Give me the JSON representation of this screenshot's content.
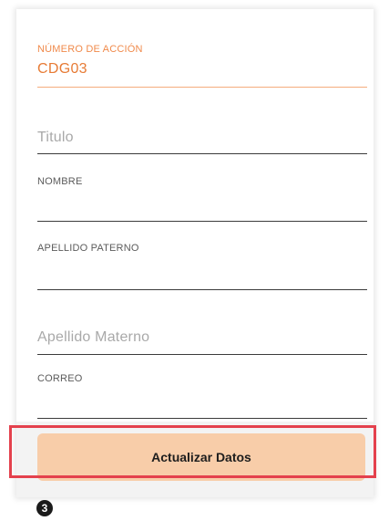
{
  "form": {
    "action_number": {
      "label": "NÚMERO DE ACCIÓN",
      "value": "CDG03"
    },
    "title": {
      "placeholder": "Titulo"
    },
    "first_name": {
      "label": "NOMBRE"
    },
    "paternal_surname": {
      "label": "APELLIDO PATERNO"
    },
    "maternal_surname": {
      "placeholder": "Apellido Materno"
    },
    "email": {
      "label": "CORREO"
    }
  },
  "button": {
    "label": "Actualizar Datos"
  },
  "callout": {
    "number": "3"
  },
  "colors": {
    "accent": "#e77b35",
    "button": "#f8cda9",
    "highlight": "#e4414d"
  }
}
